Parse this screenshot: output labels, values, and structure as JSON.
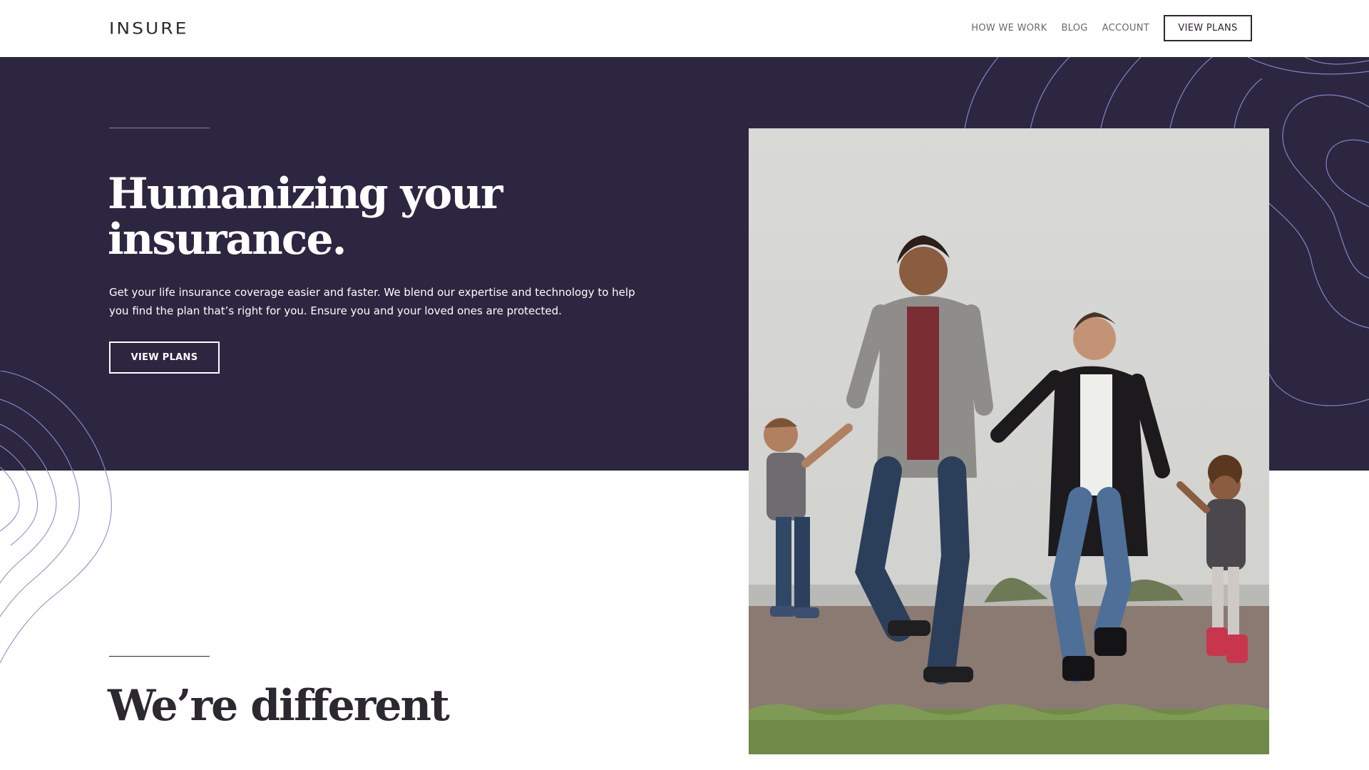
{
  "header": {
    "logo": "INSURE",
    "nav": [
      "HOW WE WORK",
      "BLOG",
      "ACCOUNT"
    ],
    "cta": "VIEW PLANS"
  },
  "hero": {
    "title": "Humanizing your insurance.",
    "text": "Get your life insurance coverage easier and faster. We blend our expertise and technology to help you find the plan that’s right for you. Ensure you and your loved ones are protected.",
    "cta": "VIEW PLANS",
    "icons": [
      "wave-contour-pattern-icon",
      "family-photo"
    ]
  },
  "section": {
    "title": "We’re different"
  },
  "colors": {
    "hero_bg": "#2c2640",
    "text_dark": "#2c2830",
    "contour": "#8a8fd0"
  }
}
